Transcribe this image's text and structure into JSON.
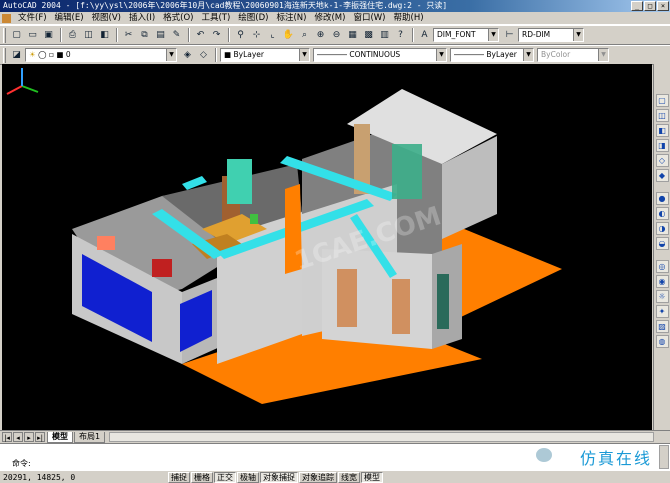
{
  "window": {
    "title": "AutoCAD 2004 - [f:\\yy\\ysl\\2006年\\2006年10月\\cad教程\\20060901海连新天地k-1-李振强住宅.dwg:2 - 只读]",
    "min": "_",
    "max": "□",
    "close": "×"
  },
  "menu": [
    "文件(F)",
    "编辑(E)",
    "视图(V)",
    "插入(I)",
    "格式(O)",
    "工具(T)",
    "绘图(D)",
    "标注(N)",
    "修改(M)",
    "窗口(W)",
    "帮助(H)"
  ],
  "toolbar1": {
    "text_style": "DIM_FONT",
    "dim_style": "RD-DIM"
  },
  "toolbar2": {
    "layer": "0",
    "color": "ByLayer",
    "linetype": "CONTINUOUS",
    "lineweight": "ByLayer",
    "plotstyle": "ByColor"
  },
  "tabs": [
    "模型",
    "布局1"
  ],
  "command": {
    "prompt": "命令:"
  },
  "status": {
    "coords": "20291, 14825, 0",
    "buttons": [
      "捕捉",
      "栅格",
      "正交",
      "极轴",
      "对象捕捉",
      "对象追踪",
      "线宽",
      "模型"
    ]
  },
  "watermark": {
    "text": "仿真在线",
    "canvas_text": "1CAE.COM"
  },
  "colors": {
    "canvas": "#000000",
    "floor": "#ff7f00",
    "wall": "#d8d8d8",
    "duct": "#33e0e8",
    "window_glass": "#1020d0"
  }
}
